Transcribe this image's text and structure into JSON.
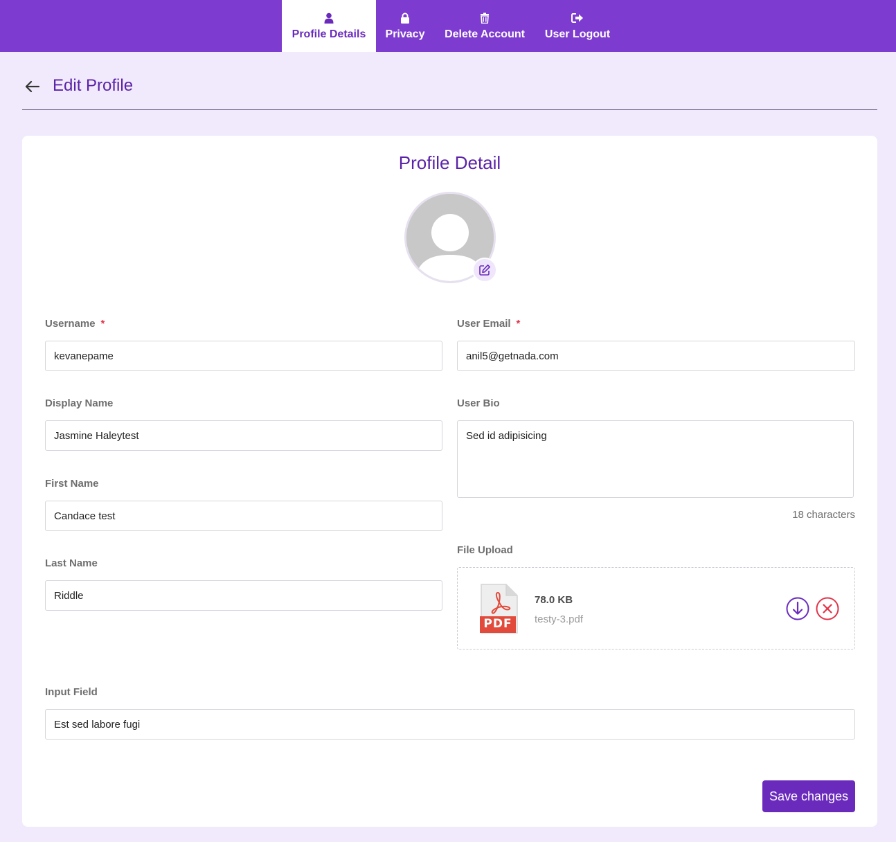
{
  "nav": {
    "tabs": [
      {
        "label": "Profile Details",
        "icon": "user-icon",
        "active": true
      },
      {
        "label": "Privacy",
        "icon": "lock-icon",
        "active": false
      },
      {
        "label": "Delete Account",
        "icon": "trash-icon",
        "active": false
      },
      {
        "label": "User Logout",
        "icon": "logout-icon",
        "active": false
      }
    ]
  },
  "header": {
    "title": "Edit Profile",
    "back_icon": "arrow-left-icon"
  },
  "card": {
    "title": "Profile Detail",
    "avatar_edit_icon": "edit-icon"
  },
  "form": {
    "username": {
      "label": "Username",
      "required": "*",
      "value": "kevanepame"
    },
    "email": {
      "label": "User Email",
      "required": "*",
      "value": "anil5@getnada.com"
    },
    "display_name": {
      "label": "Display Name",
      "value": "Jasmine Haleytest"
    },
    "bio": {
      "label": "User Bio",
      "value": "Sed id adipisicing",
      "char_count": "18 characters"
    },
    "first_name": {
      "label": "First Name",
      "value": "Candace test"
    },
    "last_name": {
      "label": "Last Name",
      "value": "Riddle"
    },
    "file_upload": {
      "label": "File Upload",
      "file_type": "PDF",
      "file_size": "78.0 KB",
      "file_name": "testy-3.pdf",
      "download_icon": "download-icon",
      "remove_icon": "close-icon"
    },
    "input_field": {
      "label": "Input Field",
      "value": "Est sed labore fugi"
    }
  },
  "actions": {
    "save_label": "Save changes"
  },
  "colors": {
    "primary": "#7d3ccf",
    "title": "#5a23a8",
    "background": "#f1e9fc",
    "danger": "#e0344a"
  }
}
